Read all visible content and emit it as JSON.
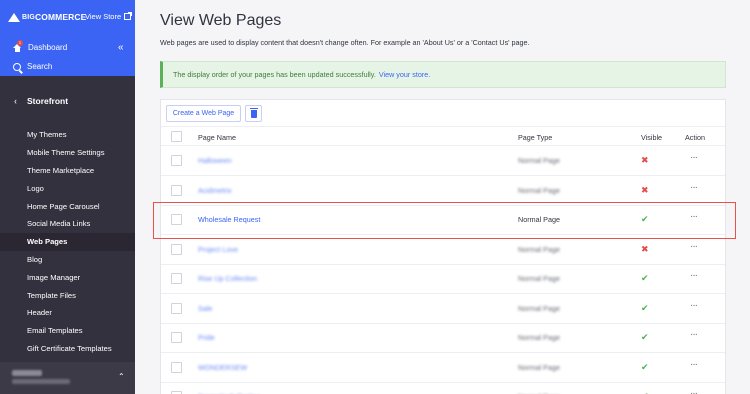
{
  "brand": {
    "big": "BIG",
    "commerce": "COMMERCE",
    "view_store": "View Store"
  },
  "sidebar": {
    "dashboard": "Dashboard",
    "dashboard_badge": "1",
    "search": "Search",
    "section": "Storefront",
    "items": [
      {
        "label": "My Themes"
      },
      {
        "label": "Mobile Theme Settings"
      },
      {
        "label": "Theme Marketplace"
      },
      {
        "label": "Logo"
      },
      {
        "label": "Home Page Carousel"
      },
      {
        "label": "Social Media Links"
      },
      {
        "label": "Web Pages",
        "active": true
      },
      {
        "label": "Blog"
      },
      {
        "label": "Image Manager"
      },
      {
        "label": "Template Files"
      },
      {
        "label": "Header"
      },
      {
        "label": "Email Templates"
      },
      {
        "label": "Gift Certificate Templates"
      }
    ]
  },
  "main": {
    "title": "View Web Pages",
    "description": "Web pages are used to display content that doesn't change often. For example an 'About Us' or a 'Contact Us' page.",
    "alert": {
      "text": "The display order of your pages has been updated successfully.",
      "link": "View your store."
    },
    "create_button": "Create a Web Page",
    "table": {
      "headers": {
        "name": "Page Name",
        "type": "Page Type",
        "visible": "Visible",
        "action": "Action"
      },
      "rows": [
        {
          "name": "Halloween",
          "type": "Normal Page",
          "visible": false,
          "blurred": true
        },
        {
          "name": "Acidmetrix",
          "type": "Normal Page",
          "visible": false,
          "blurred": true
        },
        {
          "name": "Wholesale Request",
          "type": "Normal Page",
          "visible": true,
          "blurred": false
        },
        {
          "name": "Project Love",
          "type": "Normal Page",
          "visible": false,
          "blurred": true
        },
        {
          "name": "Rise Up Collection",
          "type": "Normal Page",
          "visible": true,
          "blurred": true
        },
        {
          "name": "Sale",
          "type": "Normal Page",
          "visible": true,
          "blurred": true
        },
        {
          "name": "Pride",
          "type": "Normal Page",
          "visible": true,
          "blurred": true
        },
        {
          "name": "WONDERSEW",
          "type": "Normal Page",
          "visible": true,
          "blurred": true
        },
        {
          "name": "Dramatic Collection",
          "type": "Normal Page",
          "visible": true,
          "blurred": true
        }
      ]
    }
  },
  "icons": {
    "visible_yes": "✔",
    "visible_no": "✖",
    "action": "···",
    "collapse": "«",
    "storefront_back": "‹",
    "footer_up": "⌃"
  },
  "colors": {
    "accent": "#3c64f4",
    "sidebar": "#34313f",
    "success": "#4caf50",
    "danger": "#e34c4c",
    "highlight": "#e8524a"
  }
}
